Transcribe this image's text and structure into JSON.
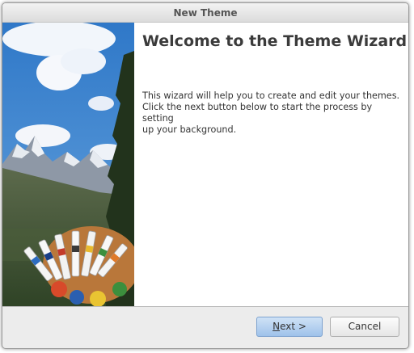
{
  "window": {
    "title": "New Theme"
  },
  "wizard": {
    "heading": "Welcome to the Theme Wizard",
    "description_lines": [
      "This wizard will help you to create and edit your themes.",
      "Click the next button below to start the process by setting",
      "up your background."
    ]
  },
  "buttons": {
    "next": {
      "mnemonic": "N",
      "rest": "ext >"
    },
    "cancel": {
      "label": "Cancel"
    }
  },
  "colors": {
    "title_text": "#555555",
    "heading_text": "#3b3b3b",
    "next_button": "#a9c8ec",
    "dialog_background": "#ececec"
  }
}
